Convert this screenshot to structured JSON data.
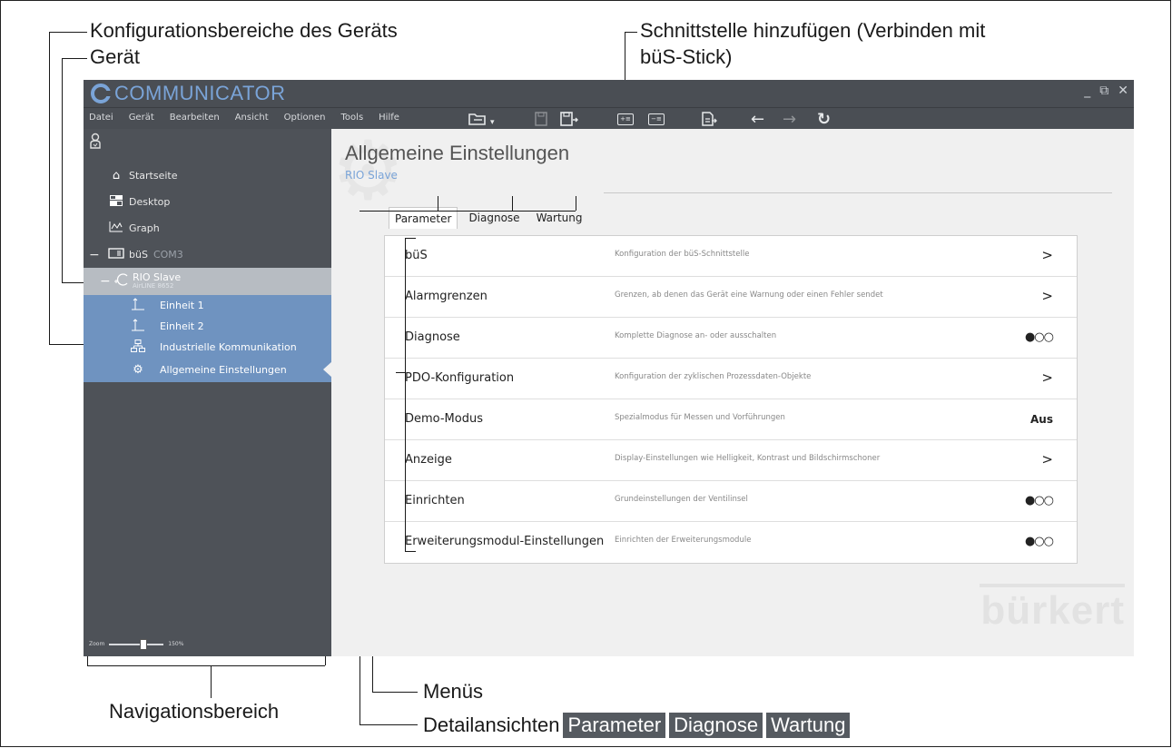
{
  "annotations": {
    "config_areas": "Konfigurationsbereiche des Geräts",
    "device": "Gerät",
    "add_interface_line1": "Schnittstelle hinzufügen (Verbinden mit",
    "add_interface_line2": "büS-Stick)",
    "navigation_area": "Navigationsbereich",
    "menus": "Menüs",
    "detail_views": "Detailansichten",
    "detail_badges": [
      "Parameter",
      "Diagnose",
      "Wartung"
    ]
  },
  "app": {
    "title": "COMMUNICATOR",
    "window_controls": [
      "_",
      "⧉",
      "✕"
    ],
    "menu": [
      "Datei",
      "Gerät",
      "Bearbeiten",
      "Ansicht",
      "Optionen",
      "Tools",
      "Hilfe"
    ],
    "toolbar_icons": [
      "open-icon",
      "dropdown-icon",
      "save-icon",
      "save-as-icon",
      "add-interface-icon",
      "remove-interface-icon",
      "export-icon",
      "back-arrow-icon",
      "forward-arrow-icon",
      "refresh-icon"
    ]
  },
  "sidebar": {
    "items": [
      {
        "label": "Startseite",
        "icon": "home-icon"
      },
      {
        "label": "Desktop",
        "icon": "desktop-icon"
      },
      {
        "label": "Graph",
        "icon": "graph-icon"
      },
      {
        "label": "büS",
        "sub": "COM3",
        "icon": "interface-icon"
      },
      {
        "label": "RIO Slave",
        "sub": "AirLINE 8652",
        "icon": "device-icon"
      },
      {
        "label": "Einheit 1",
        "icon": "unit-icon"
      },
      {
        "label": "Einheit 2",
        "icon": "unit-icon"
      },
      {
        "label": "Industrielle Kommunikation",
        "icon": "network-icon"
      },
      {
        "label": "Allgemeine Einstellungen",
        "icon": "settings-icon"
      }
    ],
    "zoom_label": "Zoom",
    "zoom_value": "150%",
    "zoom_level_percent": 150
  },
  "content": {
    "title": "Allgemeine Einstellungen",
    "subtitle": "RIO Slave",
    "tabs": [
      "Parameter",
      "Diagnose",
      "Wartung"
    ],
    "active_tab": "Parameter",
    "rows": [
      {
        "label": "büS",
        "desc": "Konfiguration der büS-Schnittstelle",
        "end": ">"
      },
      {
        "label": "Alarmgrenzen",
        "desc": "Grenzen, ab denen das Gerät eine Warnung oder einen Fehler sendet",
        "end": ">"
      },
      {
        "label": "Diagnose",
        "desc": "Komplette Diagnose an- oder ausschalten",
        "end": "●○○"
      },
      {
        "label": "PDO-Konfiguration",
        "desc": "Konfiguration der zyklischen Prozessdaten-Objekte",
        "end": ">"
      },
      {
        "label": "Demo-Modus",
        "desc": "Spezialmodus für Messen und Vorführungen",
        "end": "Aus"
      },
      {
        "label": "Anzeige",
        "desc": "Display-Einstellungen wie Helligkeit, Kontrast und Bildschirmschoner",
        "end": ">"
      },
      {
        "label": "Einrichten",
        "desc": "Grundeinstellungen der Ventilinsel",
        "end": "●○○"
      },
      {
        "label": "Erweiterungsmodul-Einstellungen",
        "desc": "Einrichten der Erweiterungsmodule",
        "end": "●○○"
      }
    ],
    "watermark": "bürkert"
  }
}
